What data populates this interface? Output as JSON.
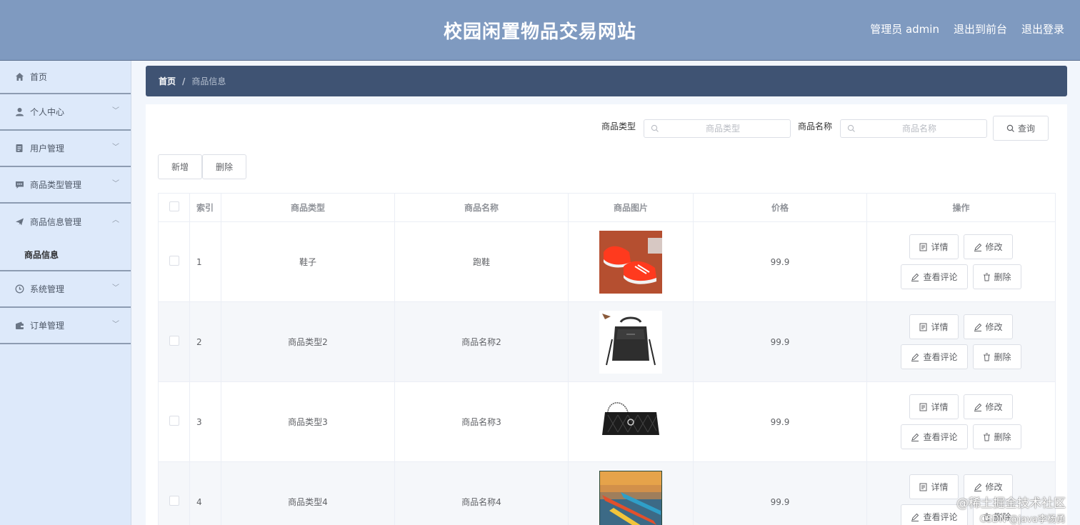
{
  "header": {
    "title": "校园闲置物品交易网站",
    "user_label": "管理员 admin",
    "frontend_link": "退出到前台",
    "logout_link": "退出登录"
  },
  "sidebar": {
    "items": [
      {
        "label": "首页",
        "icon": "home-icon"
      },
      {
        "label": "个人中心",
        "icon": "user-icon"
      },
      {
        "label": "用户管理",
        "icon": "document-icon"
      },
      {
        "label": "商品类型管理",
        "icon": "chat-icon"
      },
      {
        "label": "商品信息管理",
        "icon": "send-icon",
        "expanded": true,
        "children": [
          {
            "label": "商品信息"
          }
        ]
      },
      {
        "label": "系统管理",
        "icon": "clock-icon"
      },
      {
        "label": "订单管理",
        "icon": "wallet-icon"
      }
    ]
  },
  "breadcrumb": {
    "home": "首页",
    "separator": "/",
    "current": "商品信息"
  },
  "search": {
    "type_label": "商品类型",
    "type_placeholder": "商品类型",
    "type_value": "",
    "name_label": "商品名称",
    "name_placeholder": "商品名称",
    "name_value": "",
    "query_button": "查询"
  },
  "actions": {
    "add_button": "新增",
    "delete_button": "删除"
  },
  "table": {
    "columns": [
      "",
      "索引",
      "商品类型",
      "商品名称",
      "商品图片",
      "价格",
      "操作"
    ],
    "rows": [
      {
        "index": "1",
        "type": "鞋子",
        "name": "跑鞋",
        "image": "red-running-shoes",
        "price": "99.9"
      },
      {
        "index": "2",
        "type": "商品类型2",
        "name": "商品名称2",
        "image": "black-shoulder-bag",
        "price": "99.9"
      },
      {
        "index": "3",
        "type": "商品类型3",
        "name": "商品名称3",
        "image": "black-quilted-handbag",
        "price": "99.9"
      },
      {
        "index": "4",
        "type": "商品类型4",
        "name": "商品名称4",
        "image": "kayaks-on-water",
        "price": "99.9"
      }
    ],
    "row_actions": {
      "detail": "详情",
      "edit": "修改",
      "comments": "查看评论",
      "delete": "删除"
    }
  },
  "watermark": {
    "line1": "@稀土掘金技术社区",
    "line2": "CSDN @java李杨勇"
  },
  "colors": {
    "header_bg": "#7f9ac0",
    "sidebar_bg": "#dde9fa",
    "breadcrumb_bg": "#3f5373"
  }
}
